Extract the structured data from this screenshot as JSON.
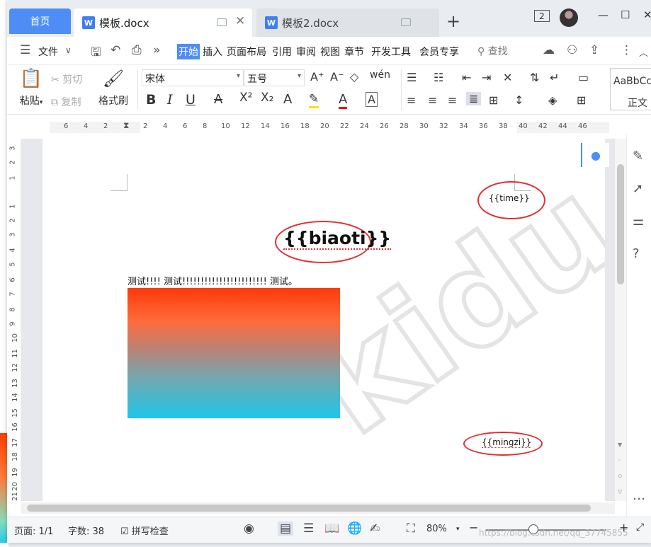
{
  "tabs": {
    "home": "首页",
    "active_doc": "模板.docx",
    "other_doc": "模板2.docx",
    "doc_icon": "W",
    "window_count": "2"
  },
  "menu": {
    "file": "文件",
    "items": [
      "开始",
      "插入",
      "页面布局",
      "引用",
      "审阅",
      "视图",
      "章节",
      "开发工具",
      "会员专享"
    ],
    "active": "开始",
    "search": "查找"
  },
  "ribbon": {
    "paste": "粘贴",
    "cut": "剪切",
    "copy": "复制",
    "format_painter": "格式刷",
    "font_name": "宋体",
    "font_size": "五号",
    "bold": "B",
    "italic": "I",
    "underline": "U",
    "style_preview": "AaBbCc",
    "style_name": "正文"
  },
  "ruler": {
    "h_left": [
      "6",
      "4",
      "2"
    ],
    "h_right": [
      "2",
      "4",
      "6",
      "8",
      "10",
      "12",
      "14",
      "16",
      "18",
      "20",
      "22",
      "24",
      "26",
      "28",
      "30",
      "32",
      "34",
      "36",
      "38",
      "40",
      "42",
      "44",
      "46"
    ],
    "v_top": [
      "3",
      "2",
      "1"
    ],
    "v_main": [
      "1",
      "2",
      "3",
      "4",
      "5",
      "6",
      "7",
      "8",
      "9",
      "10",
      "11",
      "12",
      "13",
      "14",
      "15",
      "16",
      "17",
      "18",
      "19",
      "20",
      "21"
    ]
  },
  "document": {
    "time_placeholder": "{{time}}",
    "title_placeholder": "{{biaoti}}",
    "body_text": "测试!!!! 测试!!!!!!!!!!!!!!!!!!!!!!! 测试。",
    "name_placeholder": "{{mingzi}}",
    "watermark": "kidu"
  },
  "status": {
    "page": "页面: 1/1",
    "words": "字数: 38",
    "spell": "拼写检查",
    "zoom": "80%",
    "url_watermark": "https://blog.csdn.net/qq_37745855"
  },
  "colors": {
    "accent": "#4e8df5",
    "annotation_red": "#e03030"
  }
}
